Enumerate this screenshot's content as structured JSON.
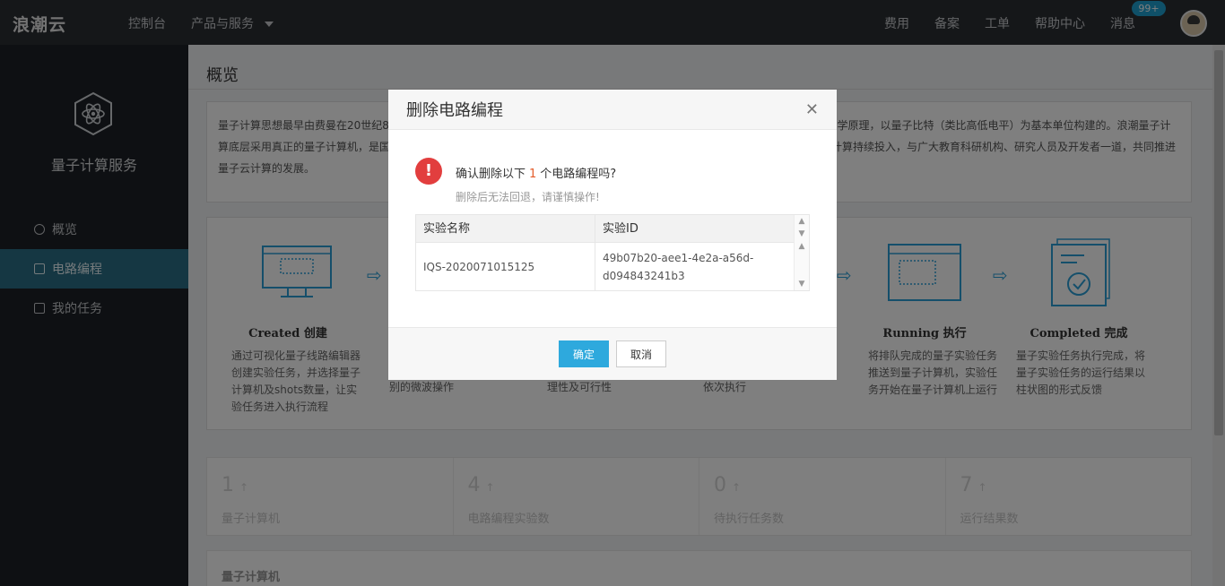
{
  "topbar": {
    "logo": "浪潮云",
    "nav_left": [
      "控制台",
      "产品与服务"
    ],
    "nav_right": [
      "费用",
      "备案",
      "工单",
      "帮助中心",
      "消息"
    ],
    "badge": "99+"
  },
  "sidebar": {
    "title": "量子计算服务",
    "items": [
      {
        "label": "概览"
      },
      {
        "label": "电路编程"
      },
      {
        "label": "我的任务"
      }
    ]
  },
  "main": {
    "title": "概览",
    "intro": "量子计算思想最早由费曼在20世纪80年代提出，量子计算机是由量子芯片和外部测控系统构成的计算系统。量子芯片是基于量子力学原理，以量子比特（类比高低电平）为基本单位构建的。浪潮量子计算底层采用真正的量子计算机，是国内领先的由真实量子计算机支撑的量子云服务平台。浪潮云依托自身优势，浪潮云将在量子云计算持续投入，与广大教育科研机构、研究人员及开发者一道，共同推进量子云计算的发展。",
    "steps": [
      {
        "title": "Created 创建",
        "desc": "通过可视化量子线路编辑器创建实验任务，并选择量子计算机及shots数量，让实验任务进入执行流程"
      },
      {
        "title": "",
        "desc": "别的微波操作"
      },
      {
        "title": "",
        "desc": "理性及可行性"
      },
      {
        "title": "",
        "desc": "依次执行"
      },
      {
        "title": "Running 执行",
        "desc": "将排队完成的量子实验任务推送到量子计算机，实验任务开始在量子计算机上运行"
      },
      {
        "title": "Completed 完成",
        "desc": "量子实验任务执行完成，将量子实验任务的运行结果以柱状图的形式反馈"
      }
    ],
    "stats": [
      {
        "num": "1",
        "label": "量子计算机"
      },
      {
        "num": "4",
        "label": "电路编程实验数"
      },
      {
        "num": "0",
        "label": "待执行任务数"
      },
      {
        "num": "7",
        "label": "运行结果数"
      }
    ],
    "stat_arrow": "↑",
    "section_title": "量子计算机"
  },
  "dialog": {
    "title": "删除电路编程",
    "confirm_prefix": "确认删除以下",
    "count": "1",
    "confirm_suffix": "个电路编程吗?",
    "sub_text": "删除后无法回退，请谨慎操作!",
    "table": {
      "headers": [
        "实验名称",
        "实验ID"
      ],
      "rows": [
        [
          "IQS-2020071015125",
          "49b07b20-aee1-4e2a-a56d-d094843241b3"
        ]
      ]
    },
    "confirm_button": "确定",
    "cancel_button": "取消"
  },
  "colors": {
    "accent": "#2ea9dd",
    "warning": "#e23e3e",
    "sidebar_active": "#2b6f86"
  }
}
